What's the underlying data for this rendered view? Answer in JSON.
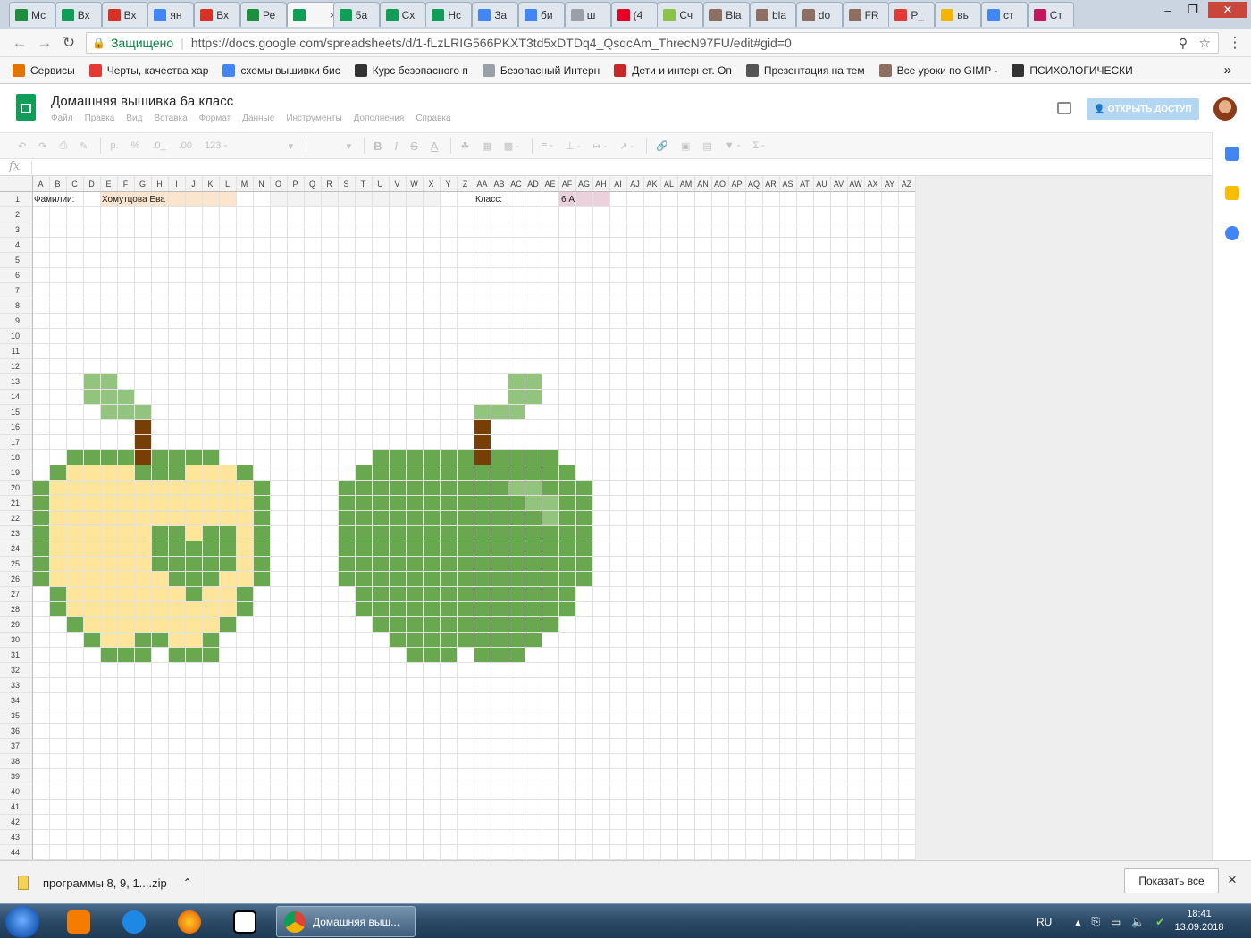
{
  "browser": {
    "tabs": [
      {
        "label": "Мс",
        "favicon": "drive-icon",
        "color": "#1e8e3e"
      },
      {
        "label": "Вх",
        "favicon": "sheets-icon",
        "color": "#0f9d58"
      },
      {
        "label": "Вх",
        "favicon": "gmail-icon",
        "color": "#d93025"
      },
      {
        "label": "ян",
        "favicon": "google-icon",
        "color": "#4285f4"
      },
      {
        "label": "Вх",
        "favicon": "gmail-icon",
        "color": "#d93025"
      },
      {
        "label": "Ре",
        "favicon": "drive-icon",
        "color": "#1e8e3e"
      },
      {
        "label": "",
        "favicon": "sheets-icon",
        "color": "#0f9d58",
        "active": true
      },
      {
        "label": "5а",
        "favicon": "sheets-icon",
        "color": "#0f9d58"
      },
      {
        "label": "Сх",
        "favicon": "sheets-icon",
        "color": "#0f9d58"
      },
      {
        "label": "Нс",
        "favicon": "sheets-icon",
        "color": "#0f9d58"
      },
      {
        "label": "За",
        "favicon": "docs-icon",
        "color": "#4285f4"
      },
      {
        "label": "би",
        "favicon": "google-icon",
        "color": "#4285f4"
      },
      {
        "label": "ш",
        "favicon": "page-icon",
        "color": "#9aa0a6"
      },
      {
        "label": "(4",
        "favicon": "pinterest-icon",
        "color": "#e60023"
      },
      {
        "label": "Сч",
        "favicon": "leaf-icon",
        "color": "#8bc34a"
      },
      {
        "label": "Bla",
        "favicon": "image-icon",
        "color": "#8d6e63"
      },
      {
        "label": "bla",
        "favicon": "image-icon",
        "color": "#8d6e63"
      },
      {
        "label": "do",
        "favicon": "image-icon",
        "color": "#8d6e63"
      },
      {
        "label": "FR",
        "favicon": "image-icon",
        "color": "#8d6e63"
      },
      {
        "label": "P_",
        "favicon": "photo-icon",
        "color": "#e53935"
      },
      {
        "label": "вь",
        "favicon": "li-icon",
        "color": "#f4b400"
      },
      {
        "label": "ст",
        "favicon": "google-icon",
        "color": "#4285f4"
      },
      {
        "label": "Ст",
        "favicon": "ring-icon",
        "color": "#c2185b"
      }
    ],
    "tab_close": "×",
    "secure_label": "Защищено",
    "url": "https://docs.google.com/spreadsheets/d/1-fLzLRIG566PKXT3td5xDTDq4_QsqcAm_ThrecN97FU/edit#gid=0",
    "bookmarks": [
      {
        "label": "Сервисы",
        "icon": "apps-icon",
        "color": "#e37400"
      },
      {
        "label": "Черты, качества хар",
        "icon": "sun-icon",
        "color": "#e53935"
      },
      {
        "label": "схемы вышивки бис",
        "icon": "google-icon",
        "color": "#4285f4"
      },
      {
        "label": "Курс безопасного п",
        "icon": "kaspersky-icon",
        "color": "#333333"
      },
      {
        "label": "Безопасный Интерн",
        "icon": "page-icon",
        "color": "#9aa0a6"
      },
      {
        "label": "Дети и интернет. Оп",
        "icon": "target-icon",
        "color": "#c62828"
      },
      {
        "label": "Презентация на тем",
        "icon": "presentation-icon",
        "color": "#555555"
      },
      {
        "label": "Все уроки по GIMP -",
        "icon": "gimp-icon",
        "color": "#8d6e63"
      },
      {
        "label": "ПСИХОЛОГИЧЕСКИ",
        "icon": "book-icon",
        "color": "#333333"
      }
    ],
    "more_bookmarks": "»"
  },
  "doc": {
    "title": "Домашняя вышивка 6а класс",
    "menu": [
      "Файл",
      "Правка",
      "Вид",
      "Вставка",
      "Формат",
      "Данные",
      "Инструменты",
      "Дополнения",
      "Справка"
    ],
    "share_label": "ОТКРЫТЬ ДОСТУП"
  },
  "toolbar": {
    "currency": "р.",
    "percent": "%",
    "dec_less": ".0_",
    "dec_more": ".00",
    "format_123": "123 -",
    "fx": "fx"
  },
  "sheet": {
    "columns": [
      "A",
      "B",
      "C",
      "D",
      "E",
      "F",
      "G",
      "H",
      "I",
      "J",
      "K",
      "L",
      "M",
      "N",
      "O",
      "P",
      "Q",
      "R",
      "S",
      "T",
      "U",
      "V",
      "W",
      "X",
      "Y",
      "Z",
      "AA",
      "AB",
      "AC",
      "AD",
      "AE",
      "AF",
      "AG",
      "AH",
      "AI",
      "AJ",
      "AK",
      "AL",
      "AM",
      "AN",
      "AO",
      "AP",
      "AQ",
      "AR",
      "AS",
      "AT",
      "AU",
      "AV",
      "AW",
      "AX",
      "AY",
      "AZ"
    ],
    "row_count": 44,
    "cells": {
      "surname_label": "Фамилии:",
      "surname_value": "Хомутцова Ева",
      "class_label": "Класс:",
      "class_value": "6 А"
    },
    "colors": {
      "dark_green": "#6aa84f",
      "light_green": "#93c47d",
      "yellow": "#ffe599",
      "brown": "#783f04",
      "peach": "#fce5cd",
      "pink": "#ead1dc",
      "grey": "#f3f3f3"
    }
  },
  "downloads": {
    "file_name": "программы 8, 9, 1....zip",
    "show_all": "Показать все",
    "close": "×"
  },
  "taskbar": {
    "chrome_label": "Домашняя выш...",
    "lang": "RU",
    "time": "18:41",
    "date": "13.09.2018"
  }
}
